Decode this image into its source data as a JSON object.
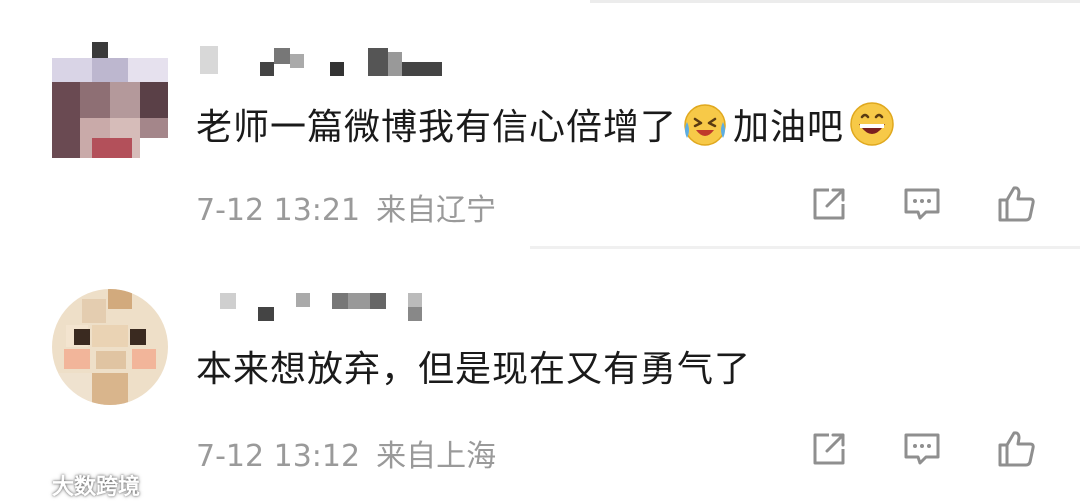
{
  "comments": [
    {
      "text": "老师一篇微博我有信心倍增了",
      "text_after_emoji": "加油吧",
      "time": "7-12 13:21",
      "location": "来自辽宁",
      "emojis": [
        "laughing-tears-emoji",
        "grinning-emoji"
      ]
    },
    {
      "text": "本来想放弃，但是现在又有勇气了",
      "time": "7-12 13:12",
      "location": "来自上海"
    }
  ],
  "actions": [
    "share-icon",
    "comment-icon",
    "thumbs-up-icon"
  ],
  "watermark": {
    "text": "大数跨境"
  },
  "colors": {
    "text": "#1a1a1a",
    "meta": "#9a9a9a",
    "icon": "#8f8f8f",
    "divider": "#eeeeee"
  }
}
